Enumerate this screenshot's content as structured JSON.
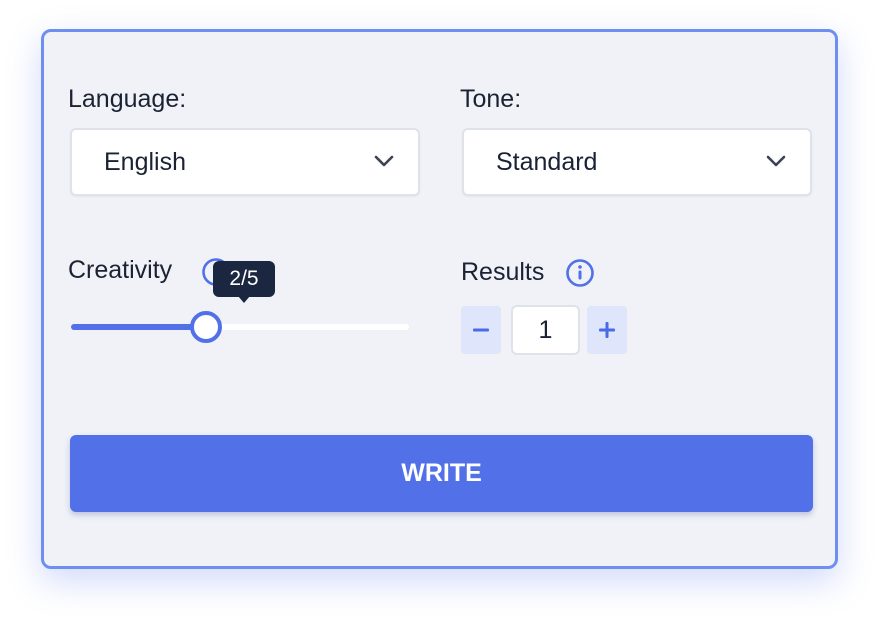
{
  "language": {
    "label": "Language:",
    "value": "English"
  },
  "tone": {
    "label": "Tone:",
    "value": "Standard"
  },
  "creativity": {
    "label": "Creativity",
    "tooltip": "2/5",
    "level": 2,
    "max": 5
  },
  "results": {
    "label": "Results",
    "value": "1",
    "decrement_icon": "minus-icon",
    "increment_icon": "plus-icon"
  },
  "write_button": {
    "label": "WRITE"
  },
  "colors": {
    "accent": "#5270e8",
    "border": "#6f8ff0",
    "card_bg": "#f0f2f8",
    "tooltip_bg": "#1b2640"
  }
}
